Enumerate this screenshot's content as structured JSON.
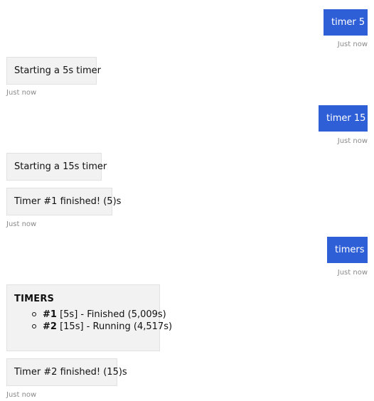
{
  "conversation": {
    "messages": [
      {
        "sender": "user",
        "text": "timer 5",
        "time": "Just now"
      },
      {
        "sender": "bot",
        "text": "Starting a 5s timer",
        "time": "Just now"
      },
      {
        "sender": "user",
        "text": "timer 15",
        "time": "Just now"
      },
      {
        "sender": "bot",
        "text": "Starting a 15s timer"
      },
      {
        "sender": "bot",
        "text": "Timer #1 finished! (5)s",
        "time": "Just now"
      },
      {
        "sender": "user",
        "text": "timers",
        "time": "Just now"
      },
      {
        "sender": "bot",
        "text": "Timer #2 finished! (15)s",
        "time": "Just now"
      }
    ],
    "timers_card": {
      "title": "TIMERS",
      "items": [
        {
          "num": "#1",
          "detail": " [5s] - Finished (5,009s)"
        },
        {
          "num": "#2",
          "detail": " [15s] - Running (4,517s)"
        }
      ]
    }
  },
  "colors": {
    "user_bubble": "#2f5fd6",
    "bot_bubble": "#f2f2f2",
    "timestamp": "#8a8a8a"
  }
}
